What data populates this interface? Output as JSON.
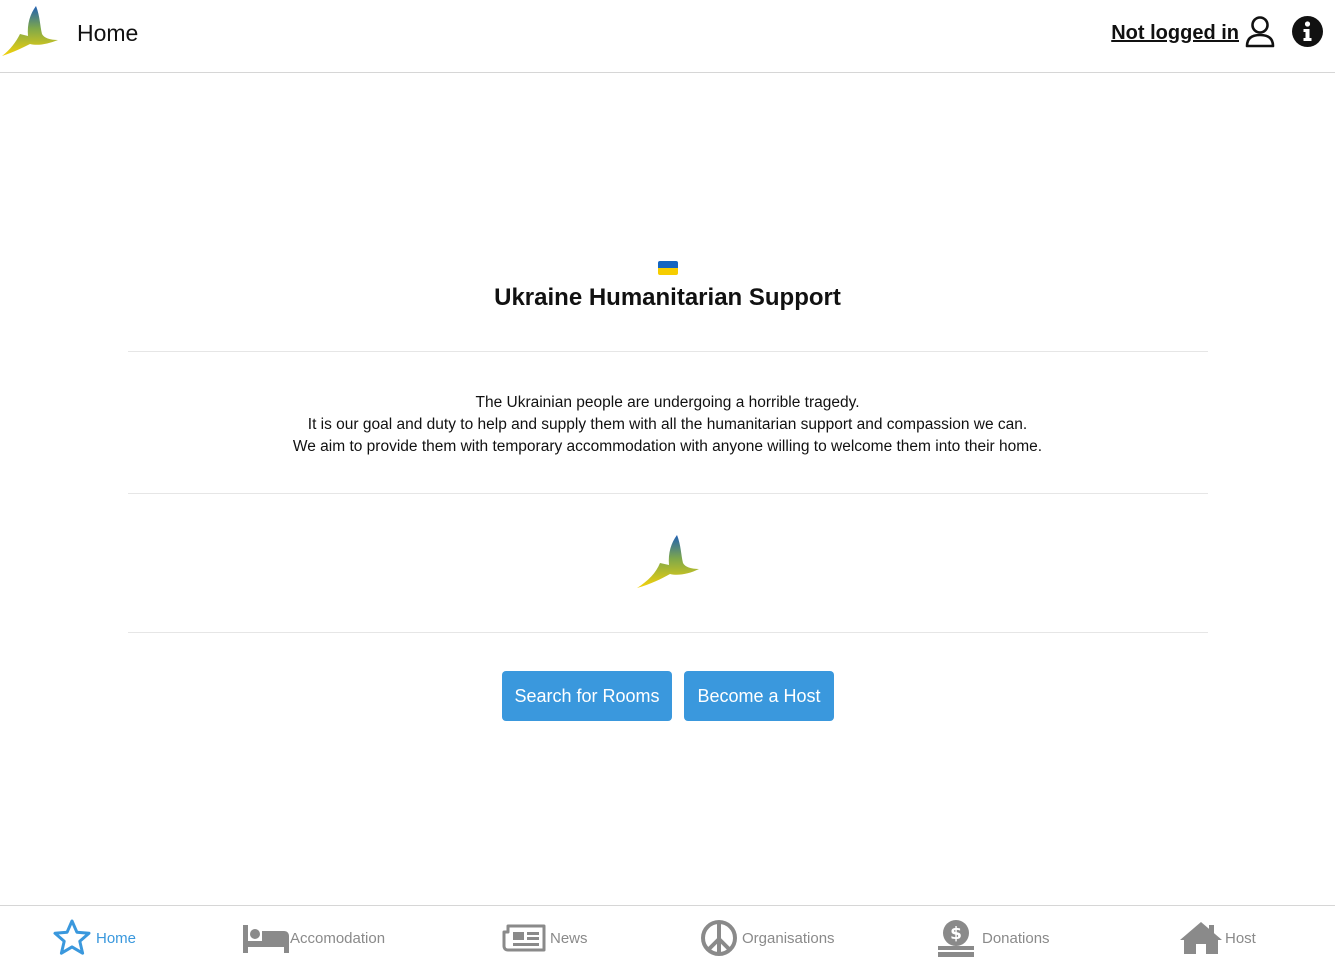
{
  "header": {
    "title": "Home",
    "login_status": "Not logged in",
    "user_icon": "user-icon",
    "info_icon": "info-circle-icon"
  },
  "main": {
    "flag_icon": "ukraine-flag-icon",
    "headline": "Ukraine Humanitarian Support",
    "intro_lines": [
      "The Ukrainian people are undergoing a horrible tragedy.",
      "It is our goal and duty to help and supply them with all the humanitarian support and compassion we can.",
      "We aim to provide them with temporary accommodation with anyone willing to welcome them into their home."
    ],
    "buttons": {
      "search_rooms": "Search for Rooms",
      "become_host": "Become a Host"
    }
  },
  "bottom_nav": {
    "items": [
      {
        "label": "Home",
        "icon": "star-icon",
        "active": true
      },
      {
        "label": "Accomodation",
        "icon": "bed-icon",
        "active": false
      },
      {
        "label": "News",
        "icon": "newspaper-icon",
        "active": false
      },
      {
        "label": "Organisations",
        "icon": "peace-icon",
        "active": false
      },
      {
        "label": "Donations",
        "icon": "donate-icon",
        "active": false
      },
      {
        "label": "Host",
        "icon": "house-icon",
        "active": false
      }
    ]
  },
  "colors": {
    "accent": "#3a98dd",
    "nav_inactive": "#8a8a8a",
    "flag_blue": "#1565c0",
    "flag_yellow": "#f6cd00"
  }
}
